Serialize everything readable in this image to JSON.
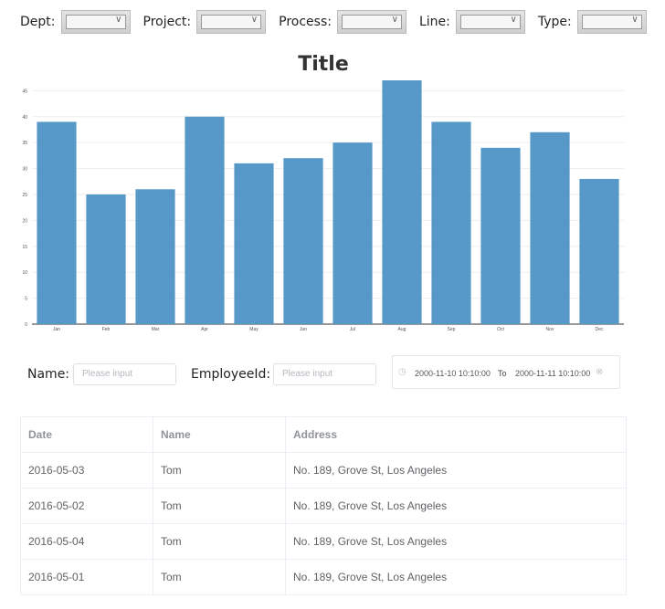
{
  "filters": [
    {
      "label": "Dept:",
      "value": ""
    },
    {
      "label": "Project:",
      "value": ""
    },
    {
      "label": "Process:",
      "value": ""
    },
    {
      "label": "Line:",
      "value": ""
    },
    {
      "label": "Type:",
      "value": ""
    }
  ],
  "search": {
    "name_label": "Name:",
    "name_placeholder": "Please input",
    "employee_label": "EmployeeId:",
    "employee_placeholder": "Please input",
    "range_start": "2000-11-10 10:10:00",
    "range_separator": "To",
    "range_end": "2000-11-11 10:10:00"
  },
  "table": {
    "columns": [
      "Date",
      "Name",
      "Address"
    ],
    "rows": [
      [
        "2016-05-03",
        "Tom",
        "No. 189, Grove St, Los Angeles"
      ],
      [
        "2016-05-02",
        "Tom",
        "No. 189, Grove St, Los Angeles"
      ],
      [
        "2016-05-04",
        "Tom",
        "No. 189, Grove St, Los Angeles"
      ],
      [
        "2016-05-01",
        "Tom",
        "No. 189, Grove St, Los Angeles"
      ]
    ]
  },
  "chart_data": {
    "type": "bar",
    "title": "Title",
    "categories": [
      "Jan",
      "Feb",
      "Mar",
      "Apr",
      "May",
      "Jun",
      "Jul",
      "Aug",
      "Sep",
      "Oct",
      "Nov",
      "Dec"
    ],
    "values": [
      39,
      25,
      26,
      40,
      31,
      32,
      35,
      47,
      39,
      34,
      37,
      28
    ],
    "ylim": [
      0,
      47
    ],
    "yticks": [
      0,
      5,
      10,
      15,
      20,
      25,
      30,
      35,
      40,
      45
    ],
    "grid": true,
    "bar_color": "#5698c8"
  }
}
